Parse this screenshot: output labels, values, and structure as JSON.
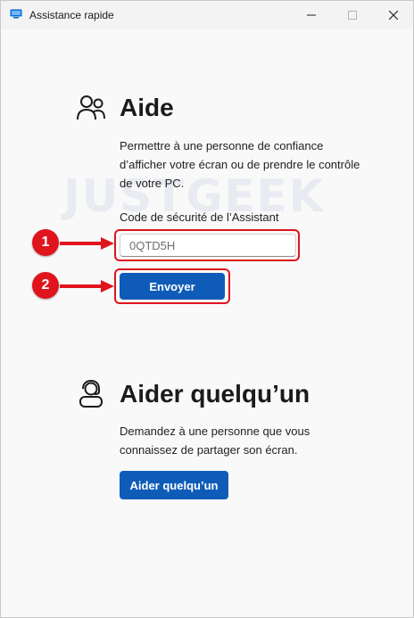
{
  "window": {
    "title": "Assistance rapide",
    "controls": {
      "minimize": "minimize-icon",
      "maximize": "maximize-icon",
      "close": "close-icon"
    }
  },
  "help_section": {
    "icon": "people-icon",
    "heading": "Aide",
    "description": "Permettre à une personne de confiance d’afficher votre écran ou de prendre le contrôle de votre PC.",
    "code_label": "Code de sécurité de l’Assistant",
    "code_value": "0QTD5H",
    "submit_label": "Envoyer"
  },
  "assist_section": {
    "icon": "person-headset-icon",
    "heading": "Aider quelqu’un",
    "description": "Demandez à une personne que vous connaissez de partager son écran.",
    "button_label": "Aider quelqu’un"
  },
  "annotations": {
    "step1": "1",
    "step2": "2",
    "highlight_color": "#e0141d"
  },
  "watermark": "JUSTGEEK",
  "colors": {
    "accent": "#0f5cb8",
    "annotation": "#e0141d"
  }
}
